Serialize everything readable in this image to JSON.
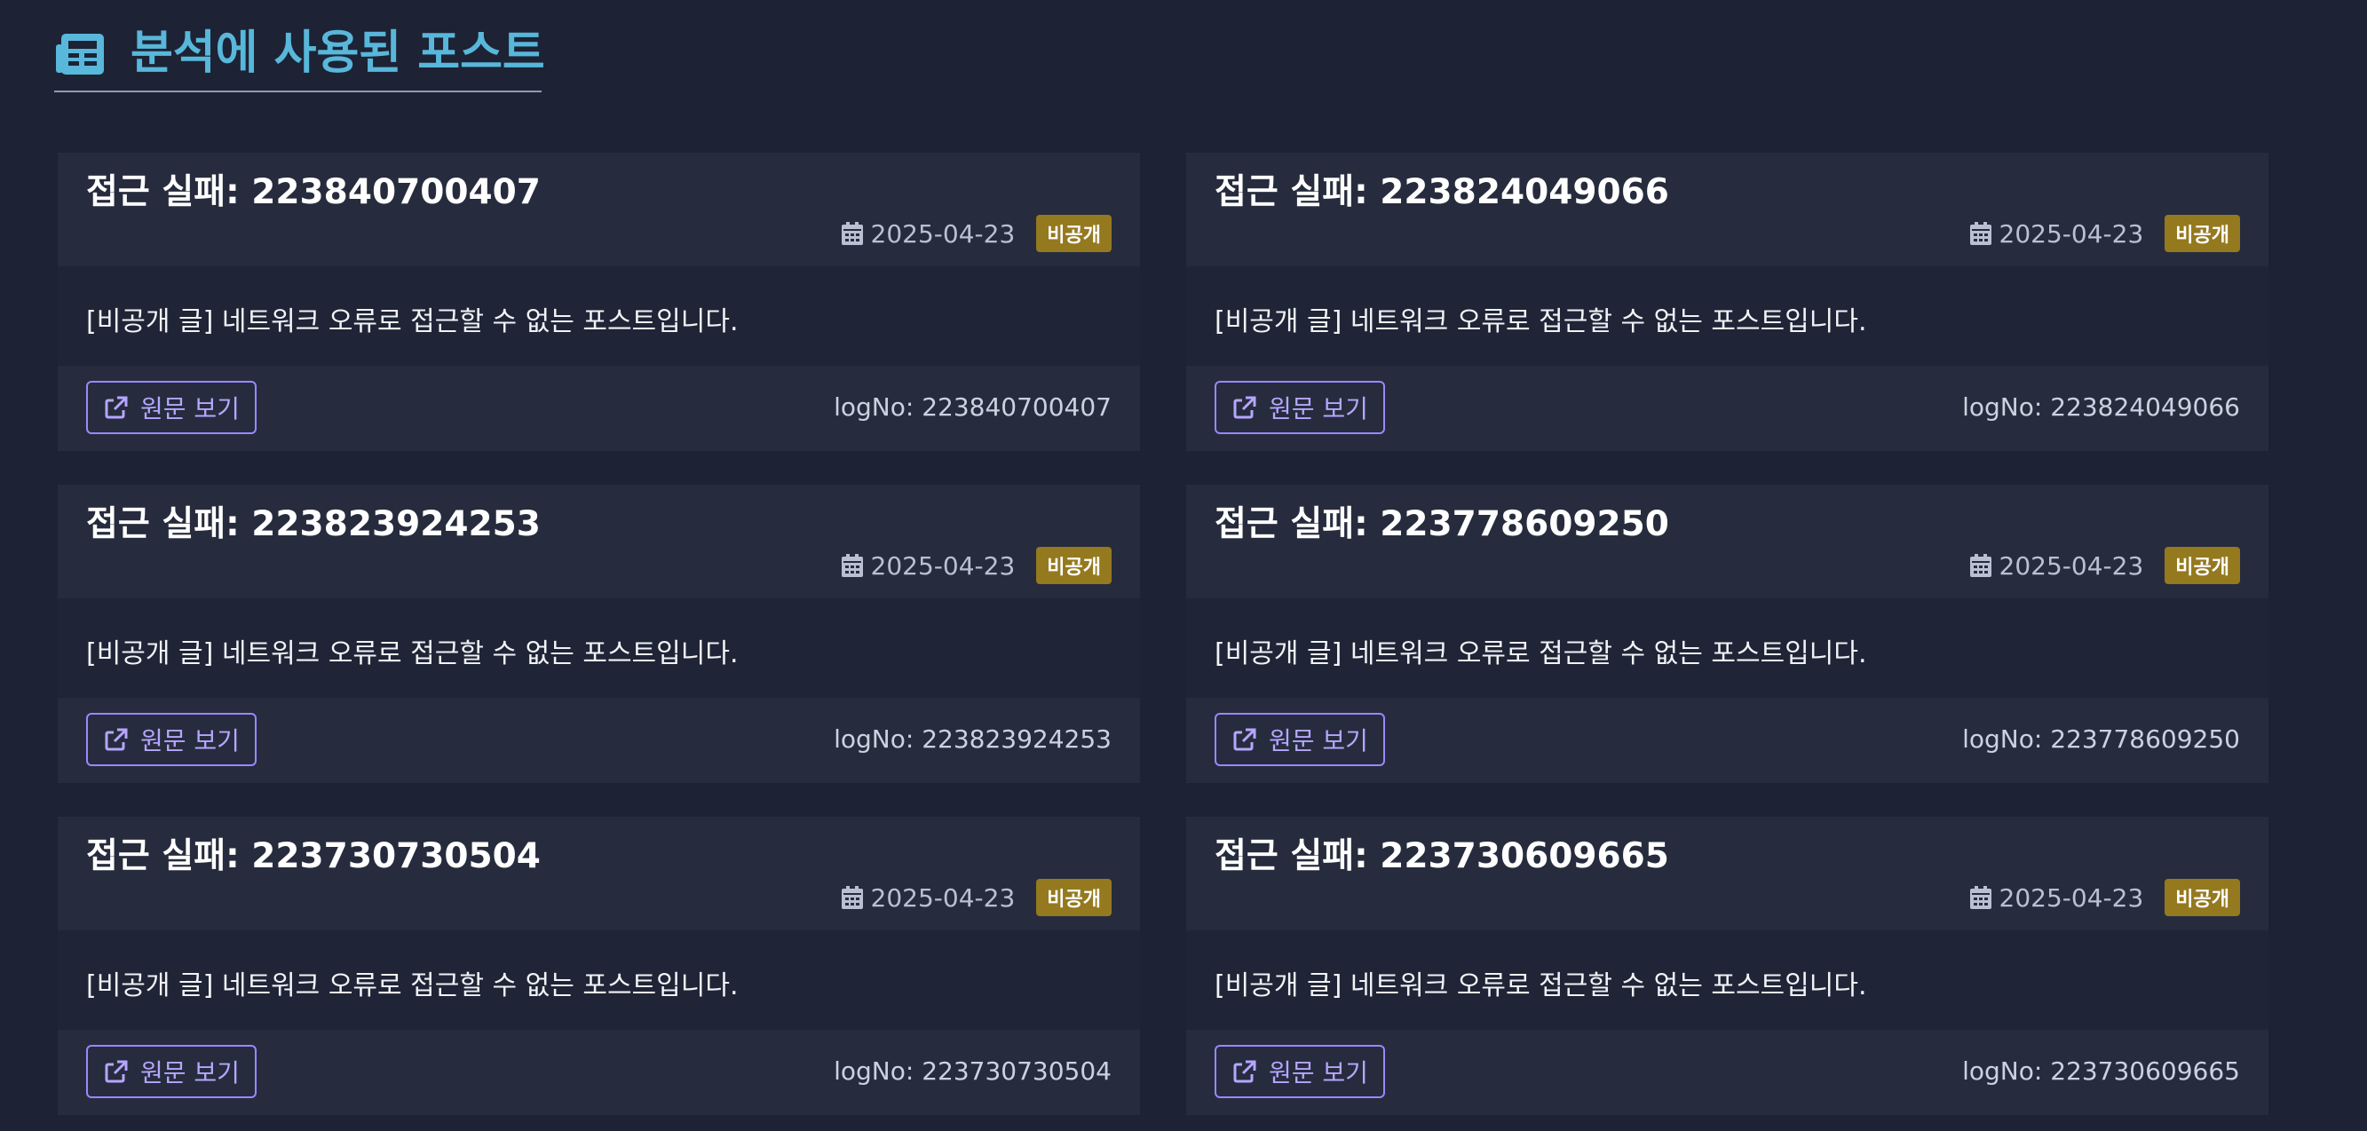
{
  "section": {
    "icon": "newspaper-icon",
    "title": "분석에 사용된 포스트"
  },
  "colors": {
    "title": "#58b7da",
    "background": "#1d2334",
    "card_header": "#262c3d",
    "badge": "#94791f",
    "button_accent": "#9a88ff"
  },
  "cards": [
    {
      "title": "접근 실패: 223840700407",
      "date": "2025-04-23",
      "badge": "비공개",
      "body": "[비공개 글] 네트워크 오류로 접근할 수 없는 포스트입니다.",
      "button_label": "원문 보기",
      "log_no": "logNo: 223840700407"
    },
    {
      "title": "접근 실패: 223824049066",
      "date": "2025-04-23",
      "badge": "비공개",
      "body": "[비공개 글] 네트워크 오류로 접근할 수 없는 포스트입니다.",
      "button_label": "원문 보기",
      "log_no": "logNo: 223824049066"
    },
    {
      "title": "접근 실패: 223823924253",
      "date": "2025-04-23",
      "badge": "비공개",
      "body": "[비공개 글] 네트워크 오류로 접근할 수 없는 포스트입니다.",
      "button_label": "원문 보기",
      "log_no": "logNo: 223823924253"
    },
    {
      "title": "접근 실패: 223778609250",
      "date": "2025-04-23",
      "badge": "비공개",
      "body": "[비공개 글] 네트워크 오류로 접근할 수 없는 포스트입니다.",
      "button_label": "원문 보기",
      "log_no": "logNo: 223778609250"
    },
    {
      "title": "접근 실패: 223730730504",
      "date": "2025-04-23",
      "badge": "비공개",
      "body": "[비공개 글] 네트워크 오류로 접근할 수 없는 포스트입니다.",
      "button_label": "원문 보기",
      "log_no": "logNo: 223730730504"
    },
    {
      "title": "접근 실패: 223730609665",
      "date": "2025-04-23",
      "badge": "비공개",
      "body": "[비공개 글] 네트워크 오류로 접근할 수 없는 포스트입니다.",
      "button_label": "원문 보기",
      "log_no": "logNo: 223730609665"
    }
  ]
}
